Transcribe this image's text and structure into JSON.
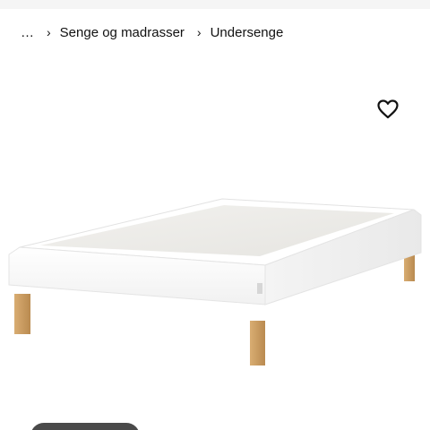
{
  "breadcrumb": {
    "more": "…",
    "separator": "›",
    "items": [
      {
        "label": "Senge og madrasser"
      },
      {
        "label": "Undersenge"
      }
    ]
  },
  "favorite": {
    "icon": "heart-outline-icon"
  },
  "product": {
    "image": "white-bed-base-with-wooden-legs"
  },
  "colors": {
    "text": "#111111",
    "fabric": "#ffffff",
    "top_panel": "#ecebe7",
    "legs": "#c89a5e",
    "pill": "#4a4a4a"
  }
}
